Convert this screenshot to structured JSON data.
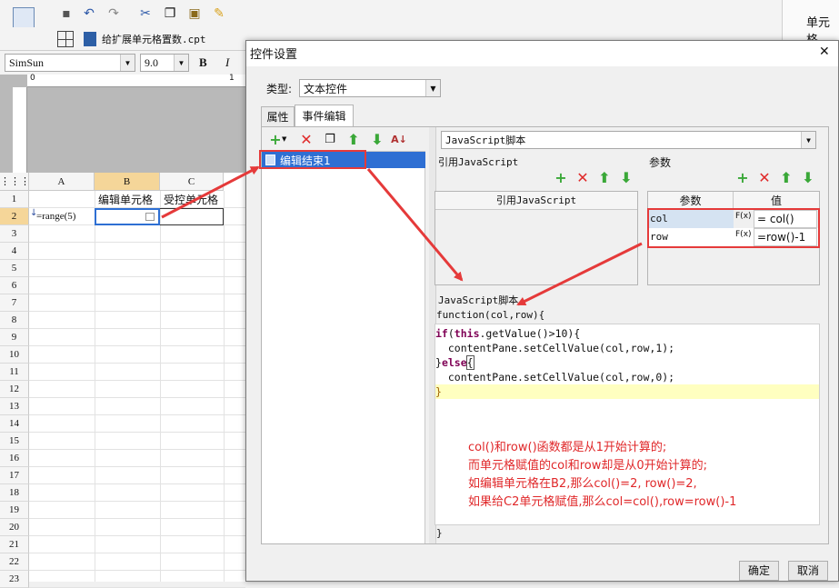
{
  "designer": {
    "tab_file": "给扩展单元格置数.cpt",
    "font_name": "SimSun",
    "font_size": "9.0",
    "bold_label": "B",
    "italic_label": "I",
    "right_panel_title": "单元格",
    "columns": [
      "A",
      "B",
      "C"
    ],
    "rows": [
      "1",
      "2",
      "3",
      "4",
      "5",
      "6",
      "7",
      "8",
      "9",
      "10",
      "11",
      "12",
      "13",
      "14",
      "15",
      "16",
      "17",
      "18",
      "19",
      "20",
      "21",
      "22",
      "23"
    ],
    "cells": {
      "b1": "编辑单元格",
      "c1": "受控单元格",
      "a2": "=range(5)"
    },
    "ruler_zero": "0",
    "ruler_one": "1"
  },
  "dialog": {
    "title": "控件设置",
    "type_label": "类型:",
    "type_value": "文本控件",
    "tabs": [
      "属性",
      "事件编辑"
    ],
    "event_item": "编辑结束1",
    "script_type": "JavaScript脚本",
    "ref_js_section": "引用JavaScript",
    "ref_js_header": "引用JavaScript",
    "params_section": "参数",
    "params_headers": [
      "参数",
      "值"
    ],
    "params": [
      {
        "name": "col",
        "fx": "F(x)",
        "value": "= col()"
      },
      {
        "name": "row",
        "fx": "F(x)",
        "value": "=row()-1"
      }
    ],
    "script_section": "JavaScript脚本",
    "func_signature": "function(col,row){",
    "code": {
      "l1_kw": "if",
      "l1_a": "(",
      "l1_this": "this",
      "l1_b": ".getValue()>10){",
      "l2": "  contentPane.setCellValue(col,row,1);",
      "l3_a": "}",
      "l3_kw": "else",
      "l3_b": "{",
      "l4": "  contentPane.setCellValue(col,row,0);",
      "l5": "}"
    },
    "closing_brace": "}",
    "notes": [
      "col()和row()函数都是从1开始计算的;",
      "而单元格赋值的col和row却是从0开始计算的;",
      "如编辑单元格在B2,那么col()=2, row()=2,",
      "如果给C2单元格赋值,那么col=col(),row=row()-1"
    ],
    "ok_label": "确定",
    "cancel_label": "取消",
    "close_glyph": "✕"
  },
  "colors": {
    "annotation": "#e53a3a",
    "selection": "#2e6fd3",
    "code_highlight": "#ffffc0"
  }
}
